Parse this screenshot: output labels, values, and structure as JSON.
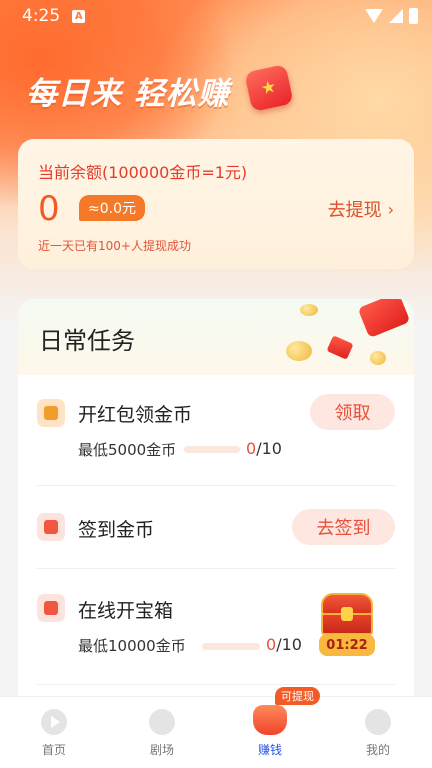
{
  "status_bar": {
    "time": "4:25",
    "notif_letter": "A"
  },
  "hero": {
    "title": "每日来 轻松赚"
  },
  "balance": {
    "label": "当前余额(100000金币=1元)",
    "value": "0",
    "approx": "≈0.0元",
    "withdraw_label": "去提现",
    "note": "近一天已有100+人提现成功"
  },
  "tasks": {
    "title": "日常任务",
    "items": [
      {
        "name": "开红包领金币",
        "sub": "最低5000金币",
        "progress_current": "0",
        "progress_total": "/10",
        "progress_fraction": 0,
        "button": "领取"
      },
      {
        "name": "签到金币",
        "button": "去签到"
      },
      {
        "name": "在线开宝箱",
        "sub": "最低10000金币",
        "progress_current": "0",
        "progress_total": "/10",
        "progress_fraction": 0,
        "timer": "01:22"
      }
    ]
  },
  "nav": {
    "badge": "可提现",
    "items": [
      {
        "label": "首页",
        "icon": "play-icon"
      },
      {
        "label": "剧场",
        "icon": "film-reel-icon"
      },
      {
        "label": "赚钱",
        "icon": "money-bag-icon",
        "active": true
      },
      {
        "label": "我的",
        "icon": "profile-icon"
      }
    ]
  },
  "colors": {
    "accent": "#f15a24",
    "active_nav": "#2a56e8"
  }
}
